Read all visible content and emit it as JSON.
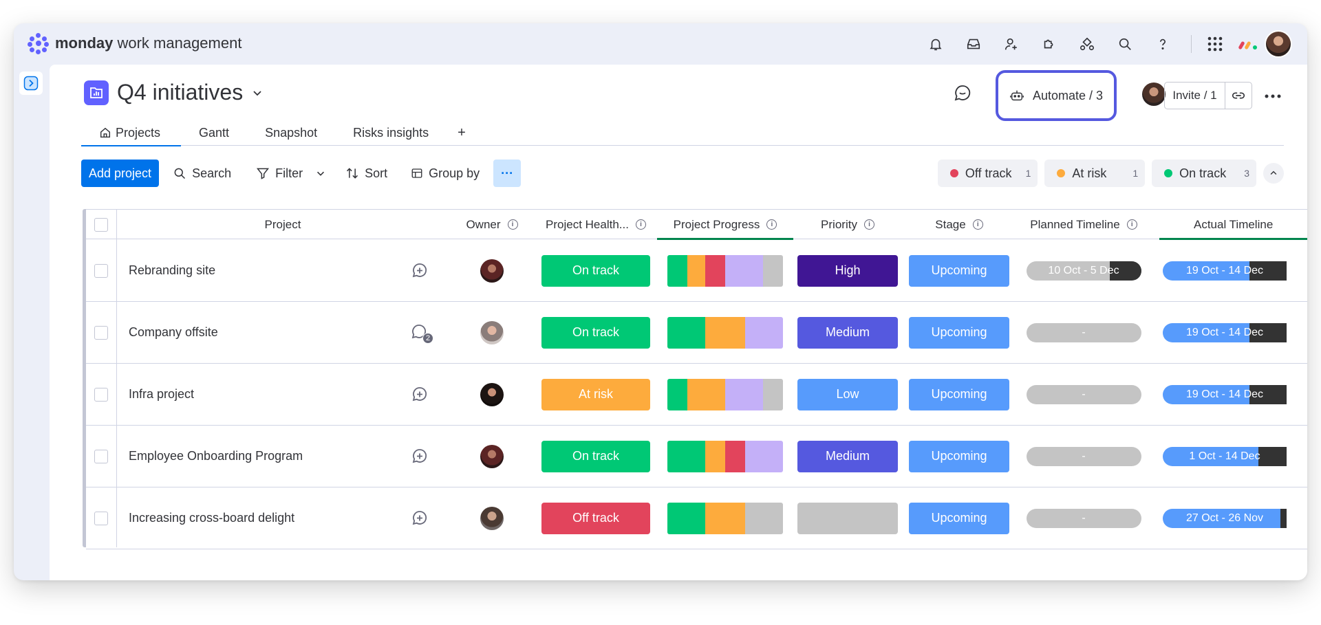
{
  "app": {
    "brand_bold": "monday",
    "brand_rest": " work management"
  },
  "topbar_icons": [
    "bell-icon",
    "inbox-icon",
    "invite-user-icon",
    "apps-puzzle-icon",
    "integrations-icon",
    "search-icon",
    "help-icon",
    "app-grid-icon"
  ],
  "board": {
    "title": "Q4 initiatives"
  },
  "header": {
    "automate_label": "Automate / 3",
    "invite_label": "Invite / 1"
  },
  "tabs": [
    {
      "label": "Projects"
    },
    {
      "label": "Gantt"
    },
    {
      "label": "Snapshot"
    },
    {
      "label": "Risks insights"
    },
    {
      "label": "+"
    }
  ],
  "toolbar": {
    "add_label": "Add project",
    "search_label": "Search",
    "filter_label": "Filter",
    "sort_label": "Sort",
    "group_label": "Group by",
    "more_label": "···"
  },
  "status_summary": [
    {
      "label": "Off track",
      "count": "1",
      "color": "#e2445c"
    },
    {
      "label": "At risk",
      "count": "1",
      "color": "#fdab3d"
    },
    {
      "label": "On track",
      "count": "3",
      "color": "#00c875"
    }
  ],
  "columns": {
    "project": "Project",
    "owner": "Owner",
    "health": "Project Health...",
    "progress": "Project Progress",
    "priority": "Priority",
    "stage": "Stage",
    "planned": "Planned Timeline",
    "actual": "Actual Timeline"
  },
  "colors": {
    "green": "#00c875",
    "orange": "#fdab3d",
    "red": "#e2445c",
    "purple": "#c4b0f8",
    "grey": "#c4c4c4",
    "high": "#401694",
    "medium": "#5559df",
    "low": "#579bfc",
    "stage": "#579bfc"
  },
  "rows": [
    {
      "name": "Rebranding site",
      "health": "On track",
      "health_color": "#00c875",
      "progress": [
        {
          "color": "#00c875",
          "fraction": 0.17
        },
        {
          "color": "#fdab3d",
          "fraction": 0.16
        },
        {
          "color": "#e2445c",
          "fraction": 0.17
        },
        {
          "color": "#c4b0f8",
          "fraction": 0.33
        },
        {
          "color": "#c4c4c4",
          "fraction": 0.17
        }
      ],
      "priority": "High",
      "priority_color": "#401694",
      "stage": "Upcoming",
      "planned": "10 Oct - 5 Dec",
      "planned_dark": 0.27,
      "actual": "19 Oct - 14 Dec",
      "actual_dark": 0.3,
      "comment_count": ""
    },
    {
      "name": "Company offsite",
      "health": "On track",
      "health_color": "#00c875",
      "progress": [
        {
          "color": "#00c875",
          "fraction": 0.33
        },
        {
          "color": "#fdab3d",
          "fraction": 0.34
        },
        {
          "color": "#c4b0f8",
          "fraction": 0.33
        }
      ],
      "priority": "Medium",
      "priority_color": "#5559df",
      "stage": "Upcoming",
      "planned": "-",
      "planned_dark": 0,
      "actual": "19 Oct - 14 Dec",
      "actual_dark": 0.3,
      "comment_count": "2"
    },
    {
      "name": "Infra project",
      "health": "At risk",
      "health_color": "#fdab3d",
      "progress": [
        {
          "color": "#00c875",
          "fraction": 0.17
        },
        {
          "color": "#fdab3d",
          "fraction": 0.33
        },
        {
          "color": "#c4b0f8",
          "fraction": 0.33
        },
        {
          "color": "#c4c4c4",
          "fraction": 0.17
        }
      ],
      "priority": "Low",
      "priority_color": "#579bfc",
      "stage": "Upcoming",
      "planned": "-",
      "planned_dark": 0,
      "actual": "19 Oct - 14 Dec",
      "actual_dark": 0.3,
      "comment_count": ""
    },
    {
      "name": "Employee Onboarding Program",
      "health": "On track",
      "health_color": "#00c875",
      "progress": [
        {
          "color": "#00c875",
          "fraction": 0.33
        },
        {
          "color": "#fdab3d",
          "fraction": 0.17
        },
        {
          "color": "#e2445c",
          "fraction": 0.17
        },
        {
          "color": "#c4b0f8",
          "fraction": 0.33
        }
      ],
      "priority": "Medium",
      "priority_color": "#5559df",
      "stage": "Upcoming",
      "planned": "-",
      "planned_dark": 0,
      "actual": "1 Oct - 14 Dec",
      "actual_dark": 0.23,
      "comment_count": ""
    },
    {
      "name": "Increasing cross-board delight",
      "health": "Off track",
      "health_color": "#e2445c",
      "progress": [
        {
          "color": "#00c875",
          "fraction": 0.33
        },
        {
          "color": "#fdab3d",
          "fraction": 0.34
        },
        {
          "color": "#c4c4c4",
          "fraction": 0.33
        }
      ],
      "priority": "",
      "priority_color": "#c4c4c4",
      "stage": "Upcoming",
      "planned": "-",
      "planned_dark": 0,
      "actual": "27 Oct - 26 Nov",
      "actual_dark": 0.05,
      "comment_count": ""
    }
  ]
}
